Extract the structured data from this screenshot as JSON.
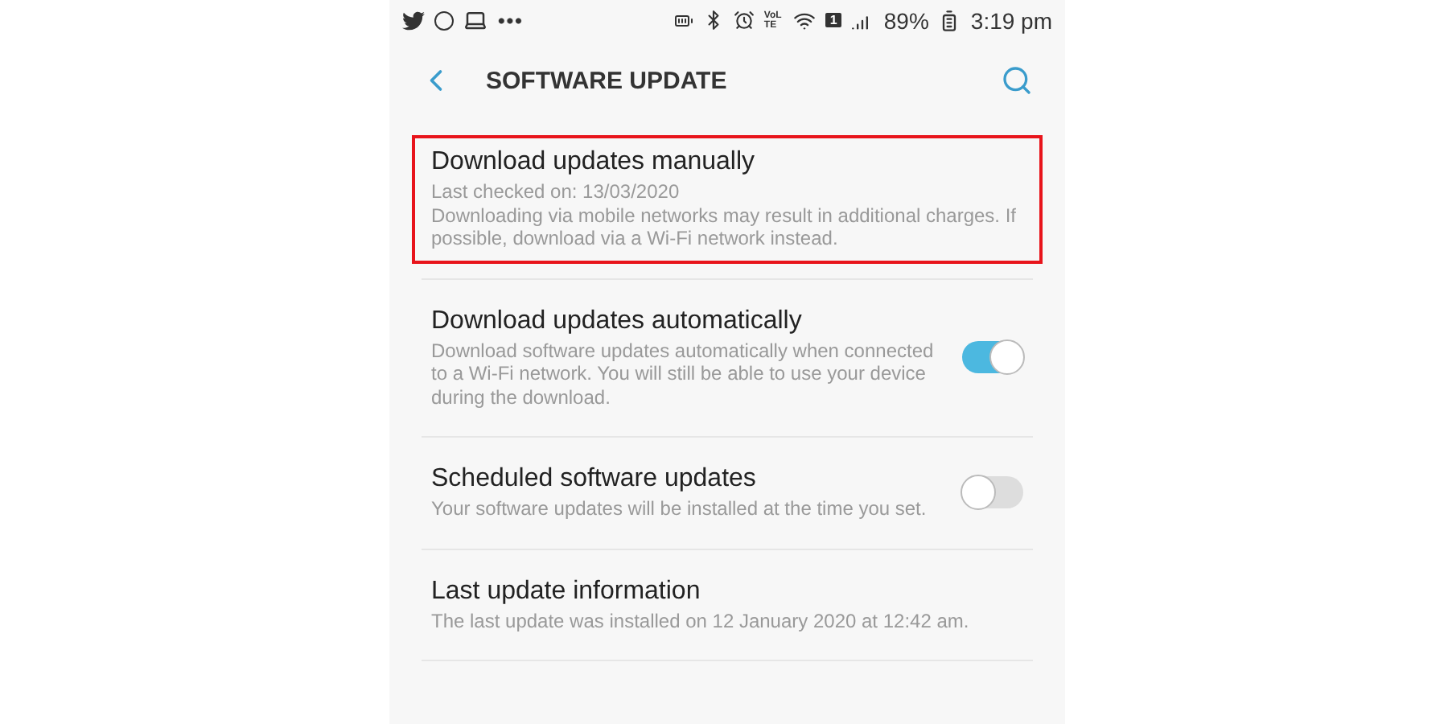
{
  "status_bar": {
    "network_label": "VoLTE",
    "sim_label": "1",
    "battery": "89%",
    "time": "3:19 pm"
  },
  "app_bar": {
    "title": "SOFTWARE UPDATE"
  },
  "items": [
    {
      "kind": "plain",
      "title": "Download updates manually",
      "lines": [
        "Last checked on: 13/03/2020",
        "Downloading via mobile networks may result in additional charges. If possible, download via a Wi-Fi network instead."
      ],
      "highlighted": true
    },
    {
      "kind": "toggle",
      "title": "Download updates automatically",
      "lines": [
        "Download software updates automatically when connected to a Wi-Fi network. You will still be able to use your device during the download."
      ],
      "on": true,
      "highlighted": false
    },
    {
      "kind": "toggle",
      "title": "Scheduled software updates",
      "lines": [
        "Your software updates will be installed at the time you set."
      ],
      "on": false,
      "highlighted": false
    },
    {
      "kind": "plain",
      "title": "Last update information",
      "lines": [
        "The last update was installed on 12 January 2020 at 12:42 am."
      ],
      "highlighted": false
    }
  ]
}
